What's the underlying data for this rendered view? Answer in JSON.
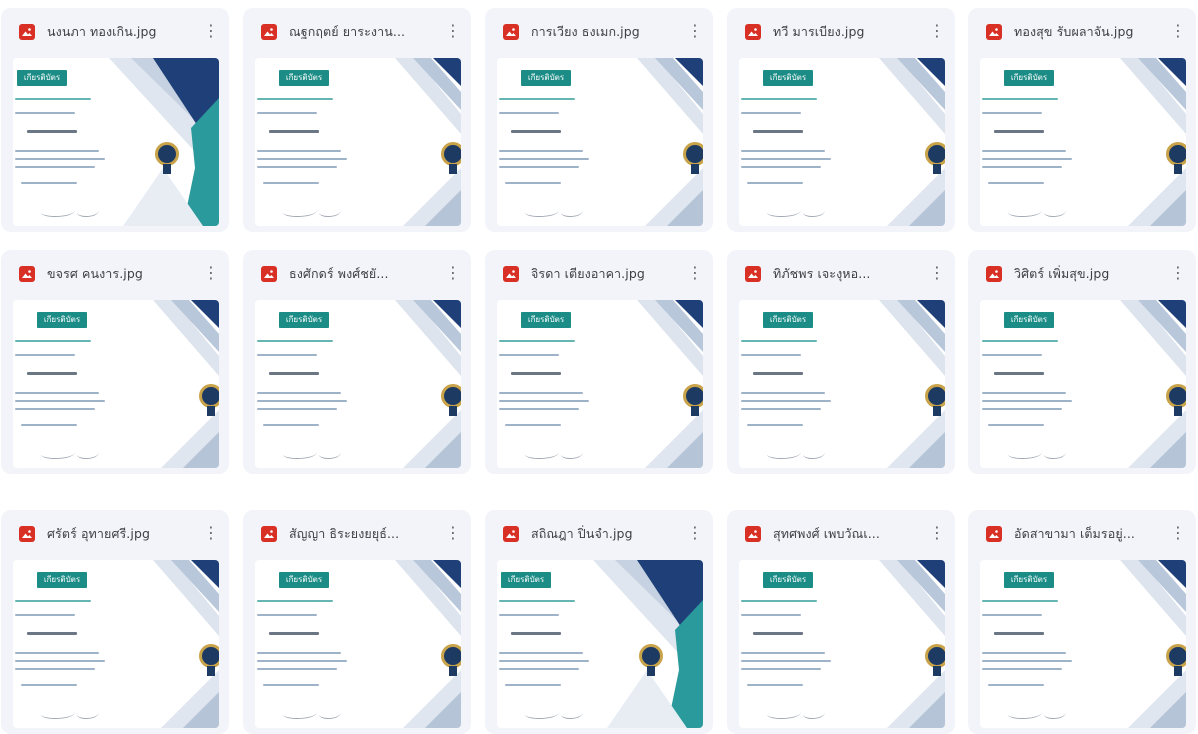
{
  "files": [
    {
      "name": "นงนภา ทองเกิน.jpg",
      "variant": "cut"
    },
    {
      "name": "ณฐกฤตย์ ยาระงาน...",
      "variant": "normal"
    },
    {
      "name": "การเวียง ธงเมก.jpg",
      "variant": "normal"
    },
    {
      "name": "ทวี มารเบียง.jpg",
      "variant": "normal"
    },
    {
      "name": "ทองสุข รับผลาจัน.jpg",
      "variant": "normal"
    },
    {
      "name": "ขจรศ คนงาร.jpg",
      "variant": "normal"
    },
    {
      "name": "ธงศักดร์ พงศ์ชยั...",
      "variant": "normal"
    },
    {
      "name": "จิรดา เตียงอาคา.jpg",
      "variant": "normal"
    },
    {
      "name": "ทิภัชพร เจะงุหอ...",
      "variant": "normal"
    },
    {
      "name": "วิศิตร์ เพิ่มสุข.jpg",
      "variant": "normal"
    },
    {
      "name": "ศรัตร์ อุทายศรี.jpg",
      "variant": "normal"
    },
    {
      "name": "สัญญา ธิระยงยยุธ์...",
      "variant": "normal"
    },
    {
      "name": "สถิณฎา ปิ่นจำ.jpg",
      "variant": "cut"
    },
    {
      "name": "สุทศพงศ์ เพบวัณเ...",
      "variant": "normal"
    },
    {
      "name": "อัดสาขามา เต็มรอยู่...",
      "variant": "normal"
    }
  ],
  "thumbnail": {
    "badge": "เกียรติบัตร"
  },
  "icons": {
    "file": "image-file-icon",
    "more": "more-vert-icon"
  },
  "colors": {
    "icon_red": "#d93025",
    "card_bg": "#f2f4f9",
    "badge_teal": "#1c8c86",
    "navy": "#1d3a63"
  }
}
